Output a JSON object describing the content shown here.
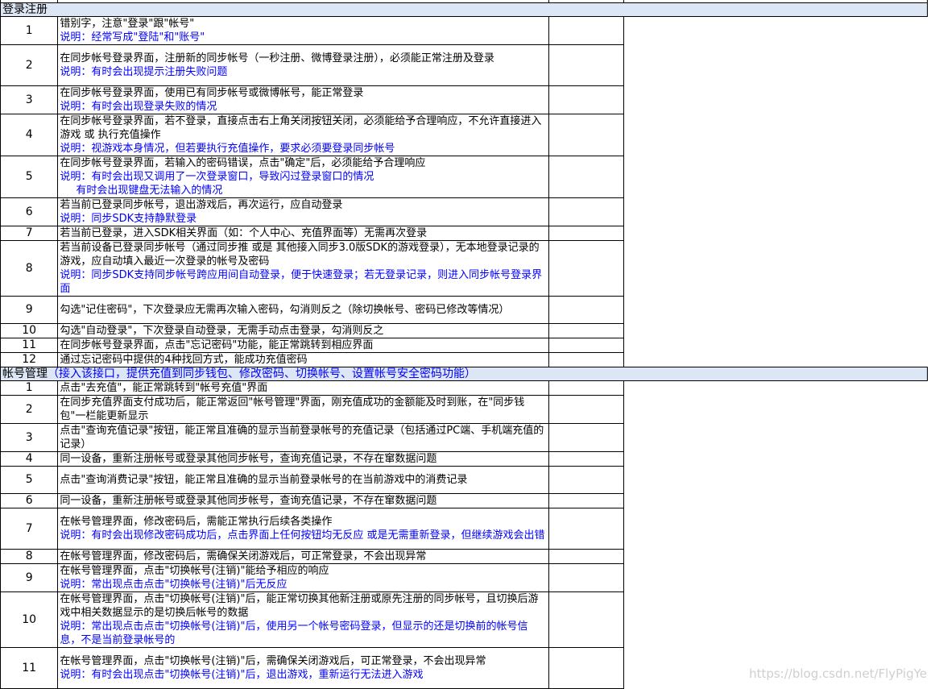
{
  "top_strip_text": "",
  "section1": {
    "title": "登录注册",
    "rows": [
      {
        "num": "1",
        "lines": [
          {
            "t": "错别字，注意\"登录\"跟\"帐号\"",
            "c": "black"
          },
          {
            "t": "说明：经常写成\"登陆\"和\"账号\"",
            "c": "blue"
          }
        ]
      },
      {
        "num": "2",
        "lines": [
          {
            "t": "在同步帐号登录界面，注册新的同步帐号（一秒注册、微博登录注册），必须能正常注册及登录",
            "c": "black"
          },
          {
            "t": "说明：有时会出现提示注册失败问题",
            "c": "blue"
          }
        ]
      },
      {
        "num": "3",
        "lines": [
          {
            "t": "在同步帐号登录界面，使用已有同步帐号或微博帐号，能正常登录",
            "c": "black"
          },
          {
            "t": "说明：有时会出现登录失败的情况",
            "c": "blue"
          }
        ]
      },
      {
        "num": "4",
        "lines": [
          {
            "t": "在同步帐号登录界面，若不登录，直接点击右上角关闭按钮关闭，必须能给予合理响应，不允许直接进入游戏 或 执行充值操作",
            "c": "black"
          },
          {
            "t": "说明：视游戏本身情况，但若要执行充值操作，要求必须要登录同步帐号",
            "c": "blue"
          }
        ]
      },
      {
        "num": "5",
        "lines": [
          {
            "t": "在同步帐号登录界面，若输入的密码错误，点击\"确定\"后，必须能给予合理响应",
            "c": "black"
          },
          {
            "t": "说明：有时会出现又调用了一次登录窗口，导致闪过登录窗口的情况",
            "c": "blue"
          },
          {
            "t": "有时会出现键盘无法输入的情况",
            "c": "blue-indent"
          }
        ]
      },
      {
        "num": "6",
        "lines": [
          {
            "t": "若当前已登录同步帐号，退出游戏后，再次运行，应自动登录",
            "c": "black"
          },
          {
            "t": "说明：同步SDK支持静默登录",
            "c": "blue"
          }
        ]
      },
      {
        "num": "7",
        "lines": [
          {
            "t": "若当前已登录，进入SDK相关界面（如：个人中心、充值界面等）无需再次登录",
            "c": "black"
          }
        ]
      },
      {
        "num": "8",
        "lines": [
          {
            "t": "若当前设备已登录同步帐号（通过同步推 或是 其他接入同步3.0版SDK的游戏登录），无本地登录记录的游戏，应自动填入最近一次登录的帐号及密码",
            "c": "black"
          },
          {
            "t": "说明：同步SDK支持同步帐号跨应用间自动登录，便于快速登录；若无登录记录，则进入同步帐号登录界面",
            "c": "blue"
          }
        ]
      },
      {
        "num": "9",
        "lines": [
          {
            "t": "勾选\"记住密码\"，下次登录应无需再次输入密码，勾消则反之（除切换帐号、密码已修改等情况）",
            "c": "black"
          }
        ]
      },
      {
        "num": "10",
        "lines": [
          {
            "t": "勾选\"自动登录\"，下次登录自动登录，无需手动点击登录，勾消则反之",
            "c": "black"
          }
        ]
      },
      {
        "num": "11",
        "lines": [
          {
            "t": "在同步帐号登录界面，点击\"忘记密码\"功能，能正常跳转到相应界面",
            "c": "black"
          }
        ]
      },
      {
        "num": "12",
        "lines": [
          {
            "t": "通过忘记密码中提供的4种找回方式，能成功充值密码",
            "c": "black"
          }
        ]
      }
    ]
  },
  "section2": {
    "title": "帐号管理",
    "title_note": "（接入该接口，提供充值到同步钱包、修改密码、切换帐号、设置帐号安全密码功能）",
    "rows": [
      {
        "num": "1",
        "lines": [
          {
            "t": "点击\"去充值\"，能正常跳转到\"帐号充值\"界面",
            "c": "black"
          }
        ]
      },
      {
        "num": "2",
        "lines": [
          {
            "t": "在同步充值界面支付成功后，能正常返回\"帐号管理\"界面，刚充值成功的金额能及时到账，在\"同步钱包\"一栏能更新显示",
            "c": "black"
          }
        ]
      },
      {
        "num": "3",
        "lines": [
          {
            "t": "点击\"查询充值记录\"按钮，能正常且准确的显示当前登录帐号的充值记录（包括通过PC端、手机端充值的记录）",
            "c": "black"
          }
        ]
      },
      {
        "num": "4",
        "lines": [
          {
            "t": "同一设备，重新注册帐号或登录其他同步帐号，查询充值记录，不存在窜数据问题",
            "c": "black"
          }
        ]
      },
      {
        "num": "5",
        "lines": [
          {
            "t": "点击\"查询消费记录\"按钮，能正常且准确的显示当前登录帐号的在当前游戏中的消费记录",
            "c": "black"
          }
        ]
      },
      {
        "num": "6",
        "lines": [
          {
            "t": "同一设备，重新注册帐号或登录其他同步帐号，查询充值记录，不存在窜数据问题",
            "c": "black"
          }
        ]
      },
      {
        "num": "7",
        "lines": [
          {
            "t": "在帐号管理界面，修改密码后，需能正常执行后续各类操作",
            "c": "black"
          },
          {
            "t": "说明：有时会出现修改密码成功后，点击界面上任何按钮均无反应 或是无需重新登录，但继续游戏会出错",
            "c": "blue"
          }
        ]
      },
      {
        "num": "8",
        "lines": [
          {
            "t": "在帐号管理界面，修改密码后，需确保关闭游戏后，可正常登录，不会出现异常",
            "c": "black"
          }
        ]
      },
      {
        "num": "9",
        "lines": [
          {
            "t": "在帐号管理界面，点击\"切换帐号(注销)\"能给予相应的响应",
            "c": "black"
          },
          {
            "t": "说明：常出现点击点击\"切换帐号(注销)\"后无反应",
            "c": "blue"
          }
        ]
      },
      {
        "num": "10",
        "lines": [
          {
            "t": "在帐号管理界面，点击\"切换帐号(注销)\"后，能正常切换其他新注册或原先注册的同步帐号，且切换后游戏中相关数据显示的是切换后帐号的数据",
            "c": "black"
          },
          {
            "t": "说明：常出现点击点击\"切换帐号(注销)\"后，使用另一个帐号密码登录，但显示的还是切换前的帐号信息，不是当前登录帐号的",
            "c": "blue"
          }
        ]
      },
      {
        "num": "11",
        "lines": [
          {
            "t": "在帐号管理界面，点击\"切换帐号(注销)\"后，需确保关闭游戏后，可正常登录，不会出现异常",
            "c": "black"
          },
          {
            "t": "说明：有时会出现点击\"切换帐号(注销)\"后，退出游戏，重新运行无法进入游戏",
            "c": "blue"
          }
        ]
      }
    ]
  },
  "watermark": "https://blog.csdn.net/FlyPigYe",
  "colors": {
    "section_bg": "#dde6f5",
    "note_blue": "#0000ff",
    "border": "#000000"
  }
}
